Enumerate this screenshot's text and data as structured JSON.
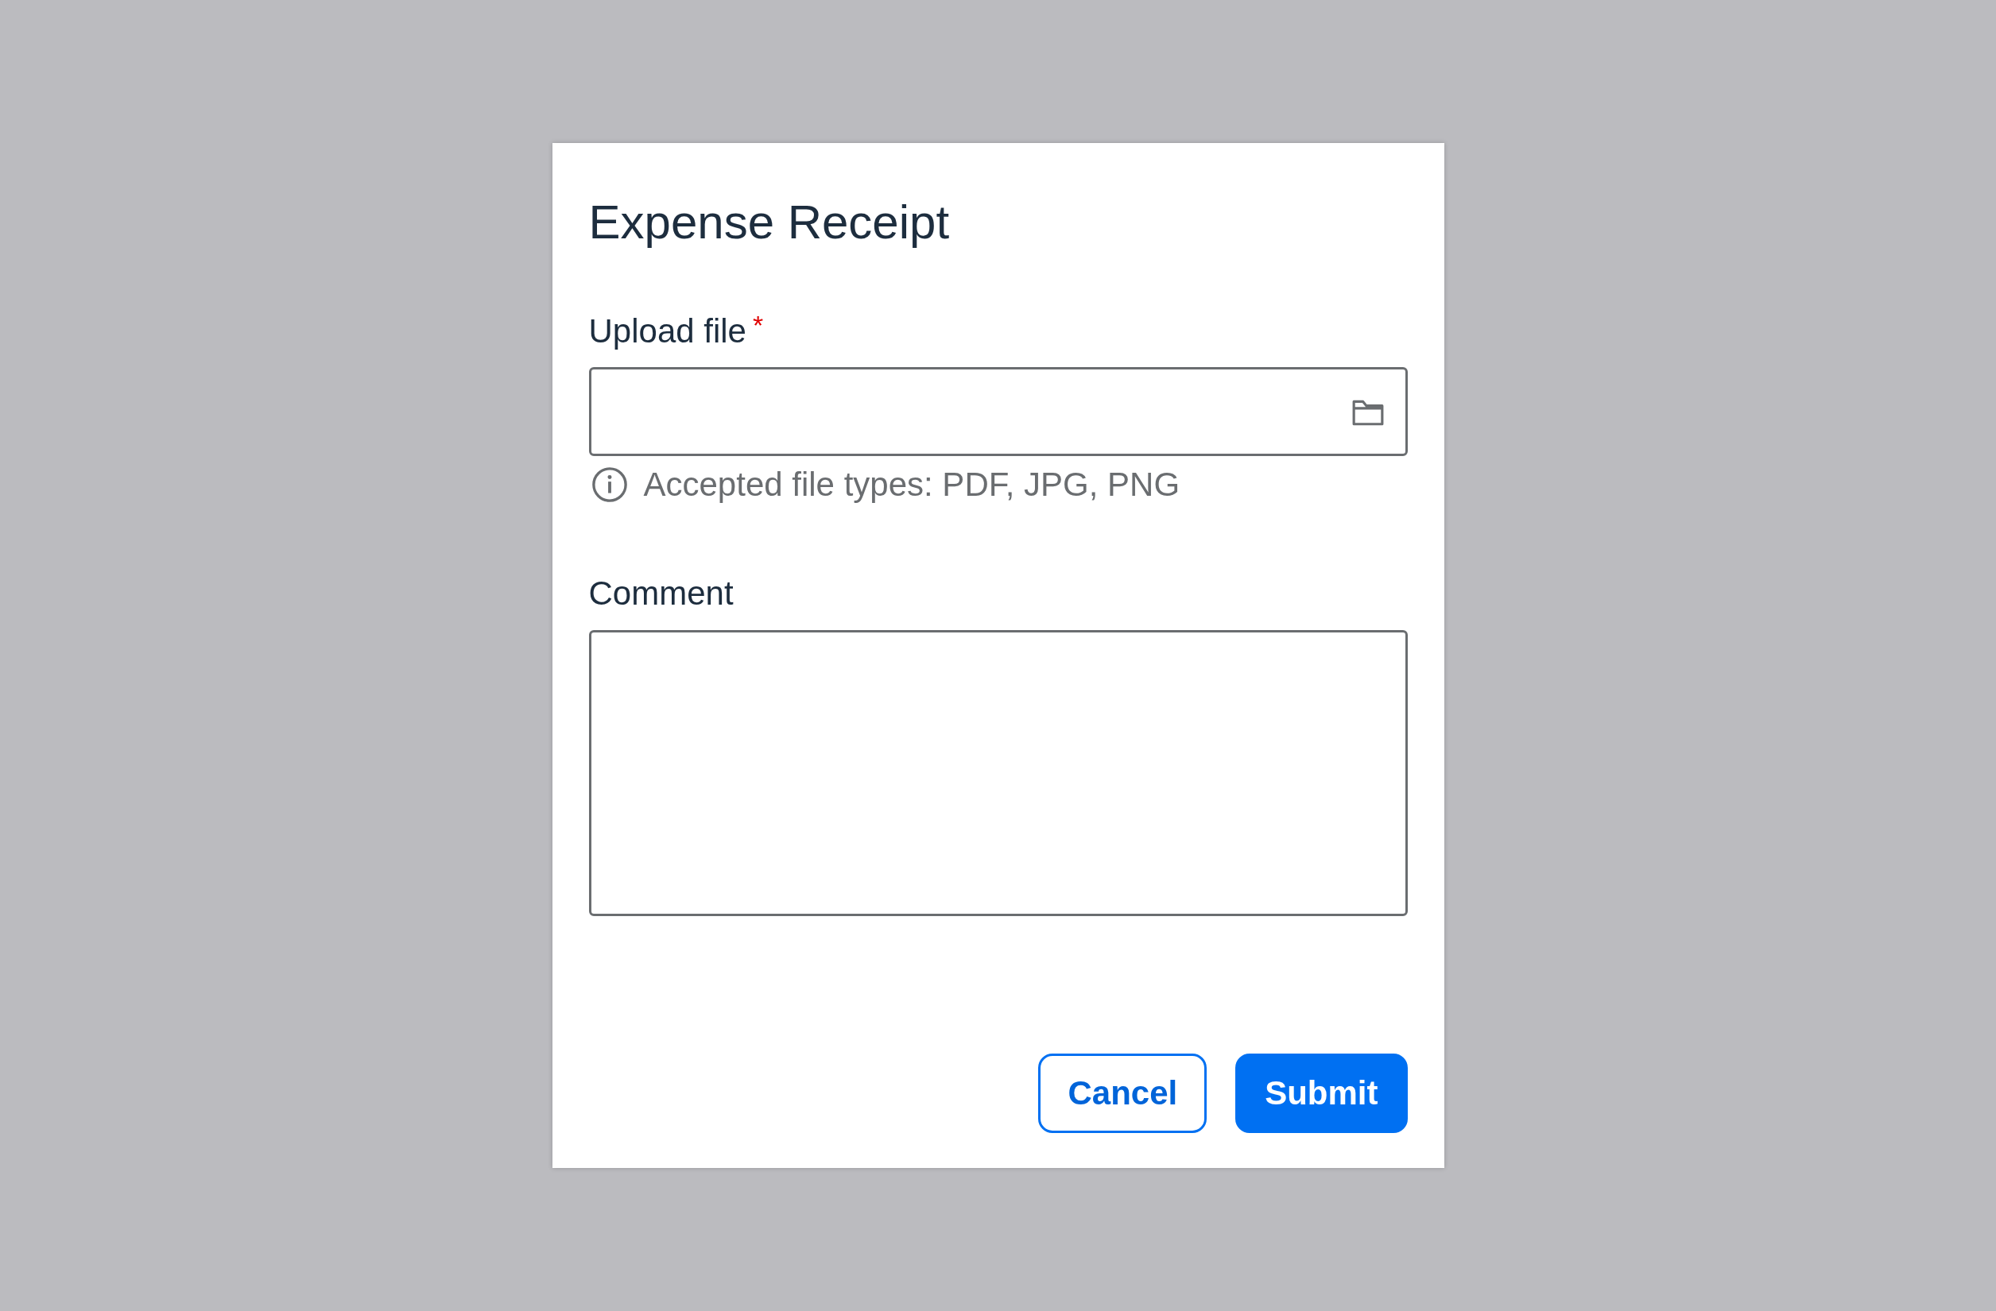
{
  "dialog": {
    "title": "Expense Receipt"
  },
  "fields": [
    {
      "kind": "file",
      "label": "Upload file",
      "required_mark": "*",
      "help": "Accepted file types: PDF, JPG, PNG"
    },
    {
      "kind": "textarea",
      "label": "Comment"
    }
  ],
  "buttons": [
    {
      "label": "Cancel",
      "kind": "secondary"
    },
    {
      "label": "Submit",
      "kind": "primary"
    }
  ]
}
